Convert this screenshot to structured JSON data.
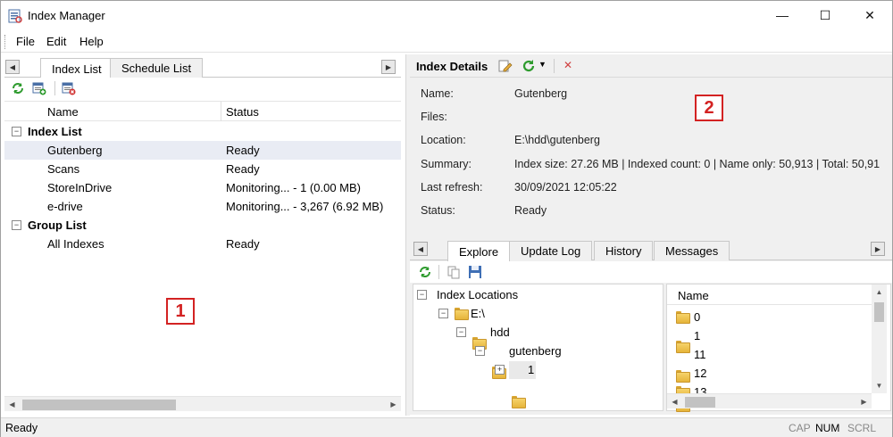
{
  "window": {
    "title": "Index Manager",
    "minimize": "—",
    "maximize": "☐",
    "close": "✕"
  },
  "menu": {
    "file": "File",
    "edit": "Edit",
    "help": "Help"
  },
  "left_tabs": {
    "index_list": "Index List",
    "schedule_list": "Schedule List"
  },
  "list": {
    "headers": {
      "name": "Name",
      "status": "Status"
    },
    "groups": [
      {
        "label": "Index List",
        "toggle": "−",
        "items": [
          {
            "name": "Gutenberg",
            "status": "Ready"
          },
          {
            "name": "Scans",
            "status": "Ready"
          },
          {
            "name": "StoreInDrive",
            "status": "Monitoring... - 1 (0.00 MB)"
          },
          {
            "name": "e-drive",
            "status": "Monitoring... - 3,267 (6.92 MB)"
          }
        ]
      },
      {
        "label": "Group List",
        "toggle": "−",
        "items": [
          {
            "name": "All Indexes",
            "status": "Ready"
          }
        ]
      }
    ]
  },
  "callouts": {
    "one": "1",
    "two": "2"
  },
  "details": {
    "title": "Index Details",
    "rows": [
      {
        "label": "Name:",
        "value": "Gutenberg"
      },
      {
        "label": "Files:",
        "value": ""
      },
      {
        "label": "Location:",
        "value": "E:\\hdd\\gutenberg"
      },
      {
        "label": "Summary:",
        "value": "Index size: 27.26 MB | Indexed count: 0 | Name only: 50,913 | Total: 50,91"
      },
      {
        "label": "Last refresh:",
        "value": "30/09/2021 12:05:22"
      },
      {
        "label": "Status:",
        "value": "Ready"
      }
    ]
  },
  "bottom_tabs": {
    "explore": "Explore",
    "update_log": "Update Log",
    "history": "History",
    "messages": "Messages"
  },
  "explore": {
    "tree": {
      "root": "Index Locations",
      "nodes": [
        {
          "label": "E:\\",
          "toggle": "−"
        },
        {
          "label": "hdd",
          "toggle": "−"
        },
        {
          "label": "gutenberg",
          "toggle": "−"
        },
        {
          "label": "1",
          "toggle": "+"
        }
      ]
    },
    "files": {
      "header": "Name",
      "items": [
        "0",
        "1",
        "11",
        "12",
        "13"
      ]
    }
  },
  "status": {
    "text": "Ready",
    "cap": "CAP",
    "num": "NUM",
    "scrl": "SCRL"
  }
}
